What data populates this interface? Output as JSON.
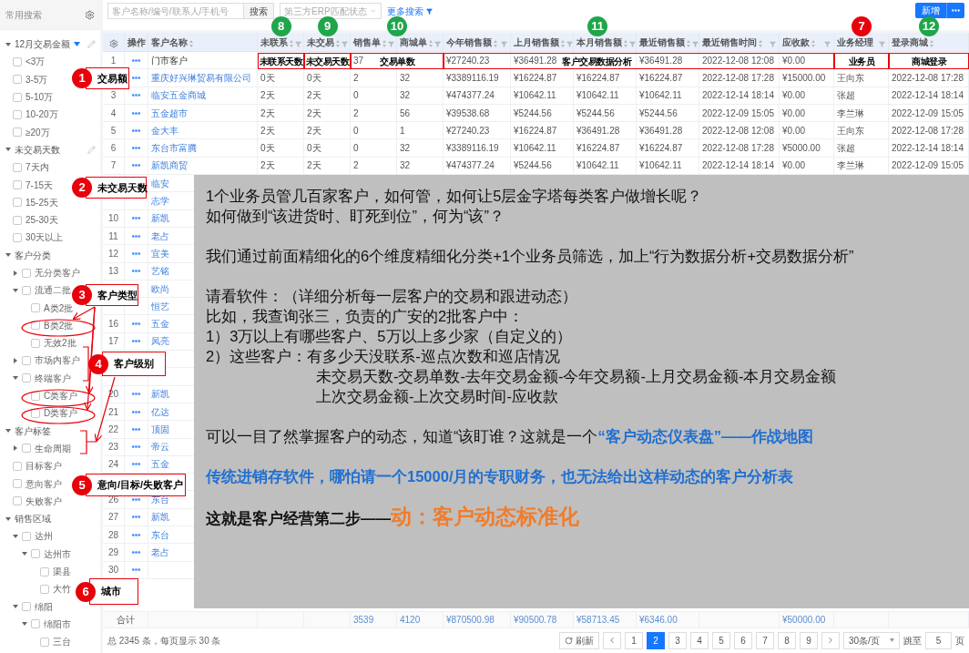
{
  "sidebar": {
    "title": "常用搜索",
    "groups": [
      {
        "kind": "group",
        "label": "12月交易金额",
        "expanded": true,
        "filtered": true,
        "editable": true,
        "children": [
          {
            "kind": "option",
            "label": "<3万",
            "checked": false
          },
          {
            "kind": "option",
            "label": "3-5万",
            "checked": false
          },
          {
            "kind": "option",
            "label": "5-10万",
            "checked": false
          },
          {
            "kind": "option",
            "label": "10-20万",
            "checked": false
          },
          {
            "kind": "option",
            "label": "≥20万",
            "checked": false
          }
        ]
      },
      {
        "kind": "group",
        "label": "未交易天数",
        "expanded": true,
        "filtered": false,
        "editable": true,
        "children": [
          {
            "kind": "option",
            "label": "7天内",
            "checked": false
          },
          {
            "kind": "option",
            "label": "7-15天",
            "checked": false
          },
          {
            "kind": "option",
            "label": "15-25天",
            "checked": false
          },
          {
            "kind": "option",
            "label": "25-30天",
            "checked": false
          },
          {
            "kind": "option",
            "label": "30天以上",
            "checked": false
          }
        ]
      },
      {
        "kind": "group",
        "label": "客户分类",
        "expanded": true,
        "filtered": false,
        "editable": false,
        "children": [
          {
            "kind": "branch",
            "label": "无分类客户",
            "checked": false,
            "expanded": false
          },
          {
            "kind": "branch",
            "label": "流通二批",
            "checked": false,
            "expanded": true,
            "children": [
              {
                "kind": "option",
                "label": "A类2批",
                "checked": false
              },
              {
                "kind": "option",
                "label": "B类2批",
                "checked": false
              },
              {
                "kind": "option",
                "label": "无效2批",
                "checked": false
              }
            ]
          },
          {
            "kind": "branch",
            "label": "市场内客户",
            "checked": false,
            "expanded": false
          },
          {
            "kind": "branch",
            "label": "终端客户",
            "checked": false,
            "expanded": true,
            "children": [
              {
                "kind": "option",
                "label": "C类客户",
                "checked": false
              },
              {
                "kind": "option",
                "label": "D类客户",
                "checked": false
              }
            ]
          }
        ]
      },
      {
        "kind": "group",
        "label": "客户标签",
        "expanded": true,
        "filtered": false,
        "editable": false,
        "children": [
          {
            "kind": "branch",
            "label": "生命周期",
            "checked": false,
            "expanded": false
          },
          {
            "kind": "option",
            "label": "目标客户",
            "checked": false
          },
          {
            "kind": "option",
            "label": "意向客户",
            "checked": false
          },
          {
            "kind": "option",
            "label": "失败客户",
            "checked": false
          }
        ]
      },
      {
        "kind": "group",
        "label": "销售区域",
        "expanded": true,
        "filtered": false,
        "editable": false,
        "children": [
          {
            "kind": "branch",
            "label": "达州",
            "checked": false,
            "expanded": true,
            "children": [
              {
                "kind": "branch",
                "label": "达州市",
                "checked": false,
                "expanded": true,
                "children": [
                  {
                    "kind": "option",
                    "label": "渠县",
                    "checked": false
                  },
                  {
                    "kind": "option",
                    "label": "大竹",
                    "checked": false
                  }
                ]
              }
            ]
          },
          {
            "kind": "branch",
            "label": "绵阳",
            "checked": false,
            "expanded": true,
            "children": [
              {
                "kind": "branch",
                "label": "绵阳市",
                "checked": false,
                "expanded": true,
                "children": [
                  {
                    "kind": "option",
                    "label": "三台",
                    "checked": false
                  }
                ]
              }
            ]
          }
        ]
      }
    ]
  },
  "toolbar": {
    "search_placeholder": "客户名称/编号/联系人/手机号",
    "search_button": "搜索",
    "erp_placeholder": "第三方ERP匹配状态",
    "more_search": "更多搜索",
    "new_button": "新增"
  },
  "table": {
    "columns": [
      {
        "label": "操作",
        "sortable": false,
        "filterable": false
      },
      {
        "label": "客户名称",
        "sortable": true,
        "filterable": false
      },
      {
        "label": "未联系",
        "sortable": true,
        "filterable": true
      },
      {
        "label": "未交易",
        "sortable": true,
        "filterable": true
      },
      {
        "label": "销售单",
        "sortable": true,
        "filterable": true
      },
      {
        "label": "商城单",
        "sortable": true,
        "filterable": true
      },
      {
        "label": "今年销售额",
        "sortable": true,
        "filterable": true
      },
      {
        "label": "上月销售额",
        "sortable": true,
        "filterable": true
      },
      {
        "label": "本月销售额",
        "sortable": true,
        "filterable": true
      },
      {
        "label": "最近销售额",
        "sortable": true,
        "filterable": true
      },
      {
        "label": "最近销售时间",
        "sortable": true,
        "filterable": true
      },
      {
        "label": "应收款",
        "sortable": true,
        "filterable": true
      },
      {
        "label": "业务经理",
        "sortable": false,
        "filterable": true
      },
      {
        "label": "登录商城",
        "sortable": true,
        "filterable": false
      }
    ],
    "rows": [
      {
        "index": "1",
        "menu": true,
        "name": "门市客户",
        "link": false,
        "cells": [
          null,
          null,
          "37",
          null,
          "¥27240.23",
          "¥36491.28",
          null,
          "¥36491.28",
          "2022-12-08 12:08",
          "¥0.00",
          null,
          null
        ]
      },
      {
        "menu": true,
        "name": "重庆好兴琳贸易有限公司",
        "link": true,
        "cells": [
          "0天",
          "0天",
          "2",
          "32",
          "¥3389116.19",
          "¥16224.87",
          "¥16224.87",
          "¥16224.87",
          "2022-12-08 17:28",
          "¥15000.00",
          "王向东",
          "2022-12-08 17:28"
        ]
      },
      {
        "index": "3",
        "menu": true,
        "name": "临安五金商城",
        "link": true,
        "cells": [
          "2天",
          "2天",
          "0",
          "32",
          "¥474377.24",
          "¥10642.11",
          "¥10642.11",
          "¥10642.11",
          "2022-12-14 18:14",
          "¥0.00",
          "张超",
          "2022-12-14 18:14"
        ]
      },
      {
        "index": "4",
        "menu": true,
        "name": "五金超市",
        "link": true,
        "cells": [
          "2天",
          "2天",
          "2",
          "56",
          "¥39538.68",
          "¥5244.56",
          "¥5244.56",
          "¥5244.56",
          "2022-12-09 15:05",
          "¥0.00",
          "李兰琳",
          "2022-12-09 15:05"
        ]
      },
      {
        "index": "5",
        "menu": true,
        "name": "金大丰",
        "link": true,
        "cells": [
          "2天",
          "2天",
          "0",
          "1",
          "¥27240.23",
          "¥16224.87",
          "¥36491.28",
          "¥36491.28",
          "2022-12-08 12:08",
          "¥0.00",
          "王向东",
          "2022-12-08 17:28"
        ]
      },
      {
        "index": "6",
        "menu": true,
        "name": "东台市富腾",
        "link": true,
        "cells": [
          "0天",
          "0天",
          "0",
          "32",
          "¥3389116.19",
          "¥10642.11",
          "¥16224.87",
          "¥16224.87",
          "2022-12-08 17:28",
          "¥5000.00",
          "张超",
          "2022-12-14 18:14"
        ]
      },
      {
        "index": "7",
        "menu": true,
        "name": "新凯商贸",
        "link": true,
        "cells": [
          "2天",
          "2天",
          "2",
          "32",
          "¥474377.24",
          "¥5244.56",
          "¥10642.11",
          "¥10642.11",
          "2022-12-14 18:14",
          "¥0.00",
          "李兰琳",
          "2022-12-09 15:05"
        ]
      },
      {
        "menu": false,
        "name": "临安",
        "link": true
      },
      {
        "menu": false,
        "name": "志学",
        "link": true
      },
      {
        "index": "10",
        "menu": true,
        "name": "新凯",
        "link": true
      },
      {
        "index": "11",
        "menu": true,
        "name": "老占",
        "link": true
      },
      {
        "index": "12",
        "menu": true,
        "name": "宜美",
        "link": true
      },
      {
        "index": "13",
        "menu": true,
        "name": "艺铭",
        "link": true
      },
      {
        "menu": false,
        "name": "欧尚",
        "link": true
      },
      {
        "menu": false,
        "name": "恒艺",
        "link": true
      },
      {
        "index": "16",
        "menu": true,
        "name": "五金",
        "link": true
      },
      {
        "index": "17",
        "menu": true,
        "name": "凤亮",
        "link": true
      },
      {
        "menu": false
      },
      {
        "menu": false
      },
      {
        "index": "20",
        "menu": true,
        "name": "新凯",
        "link": true
      },
      {
        "index": "21",
        "menu": true,
        "name": "亿达",
        "link": true
      },
      {
        "index": "22",
        "menu": true,
        "name": "顶固",
        "link": true
      },
      {
        "index": "23",
        "menu": true,
        "name": "帝云",
        "link": true
      },
      {
        "index": "24",
        "menu": true,
        "name": "五金",
        "link": true
      },
      {
        "menu": false
      },
      {
        "index": "26",
        "menu": true,
        "name": "东台",
        "link": true
      },
      {
        "index": "27",
        "menu": true,
        "name": "新凯",
        "link": true
      },
      {
        "index": "28",
        "menu": true,
        "name": "东台",
        "link": true
      },
      {
        "index": "29",
        "menu": true,
        "name": "老占",
        "link": true
      },
      {
        "index": "30",
        "menu": true
      }
    ],
    "totals": {
      "label": "合计",
      "cells": [
        null,
        null,
        "3539",
        "4120",
        "¥870500.98",
        "¥90500.78",
        "¥58713.45",
        "¥6346.00",
        null,
        "¥50000.00",
        null,
        null
      ]
    }
  },
  "pagination": {
    "summary": "总 2345 条，每页显示 30 条",
    "refresh": "刷新",
    "pages": [
      {
        "label": "1",
        "selected": false
      },
      {
        "label": "2",
        "selected": true
      },
      {
        "label": "3",
        "selected": false
      },
      {
        "label": "4",
        "selected": false
      },
      {
        "label": "5",
        "selected": false
      },
      {
        "label": "6",
        "selected": false
      },
      {
        "label": "7",
        "selected": false
      },
      {
        "label": "8",
        "selected": false
      },
      {
        "label": "9",
        "selected": false
      }
    ],
    "page_size": "30条/页",
    "jump_label": "跳至",
    "jump_value": "5",
    "page_suffix": "页"
  },
  "annotations": [
    {
      "number": "8",
      "color": "#1fa64a",
      "label": "未联系天数"
    },
    {
      "number": "9",
      "color": "#1fa64a",
      "label": "未交易天数"
    },
    {
      "number": "10",
      "color": "#1fa64a",
      "label": "交易单数"
    },
    {
      "number": "11",
      "color": "#1fa64a",
      "label": "客户交易数据分析"
    },
    {
      "number": "7",
      "color": "#e8000b",
      "label": "业务员"
    },
    {
      "number": "12",
      "color": "#1fa64a",
      "label": "商城登录"
    },
    {
      "number": "1",
      "color": "#e8000b",
      "label": "交易额"
    },
    {
      "number": "2",
      "color": "#e8000b",
      "label": "未交易天数"
    },
    {
      "number": "3",
      "color": "#e8000b",
      "label": "客户类型"
    },
    {
      "number": "4",
      "color": "#e8000b",
      "label": "客户级别"
    },
    {
      "number": "5",
      "color": "#e8000b",
      "label": "意向/目标/失败客户"
    },
    {
      "number": "6",
      "color": "#e8000b",
      "label": "城市"
    }
  ],
  "notes": [
    {
      "lines": [
        {
          "indent": false,
          "parts": [
            {
              "kind": "plain",
              "text": "1个业务员管几百家客户，如何管，如何让5层金字塔每类客户做增长呢？"
            }
          ]
        },
        {
          "indent": false,
          "parts": [
            {
              "kind": "plain",
              "text": "如何做到“该进货时、盯死到位”，何为“该”？"
            }
          ]
        }
      ]
    },
    {
      "lines": [
        {
          "indent": false,
          "parts": [
            {
              "kind": "plain",
              "text": "我们通过前面精细化的6个维度精细化分类+1个业务员筛选，加上“行为数据分析+交易数据分析”"
            }
          ]
        }
      ]
    },
    {
      "lines": [
        {
          "indent": false,
          "parts": [
            {
              "kind": "plain",
              "text": "请看软件：（详细分析每一层客户的交易和跟进动态）"
            }
          ]
        },
        {
          "indent": false,
          "parts": [
            {
              "kind": "plain",
              "text": "比如，我查询张三，负责的广安的2批客户中："
            }
          ]
        },
        {
          "indent": false,
          "parts": [
            {
              "kind": "plain",
              "text": "1）3万以上有哪些客户、5万以上多少家（自定义的）"
            }
          ]
        },
        {
          "indent": false,
          "parts": [
            {
              "kind": "plain",
              "text": "2）这些客户：有多少天没联系-巡点次数和巡店情况"
            }
          ]
        },
        {
          "indent": true,
          "parts": [
            {
              "kind": "plain",
              "text": "未交易天数-交易单数-去年交易金额-今年交易额-上月交易金额-本月交易金额"
            }
          ]
        },
        {
          "indent": true,
          "parts": [
            {
              "kind": "plain",
              "text": "上次交易金额-上次交易时间-应收款"
            }
          ]
        }
      ]
    },
    {
      "lines": [
        {
          "indent": false,
          "parts": [
            {
              "kind": "plain",
              "text": "可以一目了然掌握客户的动态，知道“该盯谁？这就是一个"
            },
            {
              "kind": "highlight",
              "text": "“客户动态仪表盘”——作战地图"
            }
          ]
        }
      ]
    },
    {
      "lines": [
        {
          "indent": false,
          "parts": [
            {
              "kind": "highlight",
              "text": "传统进销存软件，哪怕请一个15000/月的专职财务，也无法给出这样动态的客户分析表"
            }
          ]
        }
      ]
    },
    {
      "lines": [
        {
          "indent": false,
          "parts": [
            {
              "kind": "strong",
              "text": "这就是客户经营第二步——"
            },
            {
              "kind": "accent",
              "text": "动：客户动态标准化"
            }
          ]
        }
      ]
    }
  ]
}
